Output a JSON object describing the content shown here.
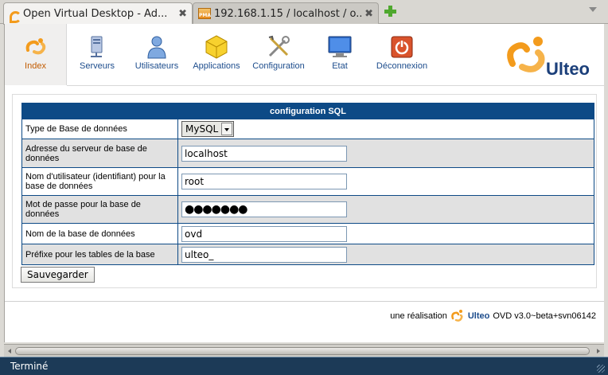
{
  "browser": {
    "tabs": [
      {
        "title": "Open Virtual Desktop - Ad...",
        "active": true,
        "icon": "ulteo-icon"
      },
      {
        "title": "192.168.1.15 / localhost / o...",
        "active": false,
        "icon": "phpmyadmin-icon"
      }
    ],
    "status_text": "Terminé"
  },
  "menu": {
    "items": [
      {
        "label": "Index",
        "icon": "ulteo-index-icon"
      },
      {
        "label": "Serveurs",
        "icon": "server-icon"
      },
      {
        "label": "Utilisateurs",
        "icon": "user-icon"
      },
      {
        "label": "Applications",
        "icon": "cube-icon"
      },
      {
        "label": "Configuration",
        "icon": "tools-icon"
      },
      {
        "label": "Etat",
        "icon": "monitor-icon"
      },
      {
        "label": "Déconnexion",
        "icon": "power-icon"
      }
    ],
    "selected": "Index"
  },
  "logo": {
    "text": "Ulteo",
    "colors": {
      "orange": "#f39b1c",
      "blue": "#1b3f7a"
    }
  },
  "form": {
    "title": "configuration SQL",
    "rows": [
      {
        "label": "Type de Base de données",
        "type": "select",
        "value": "MySQL"
      },
      {
        "label": "Adresse du serveur de base de données",
        "type": "text",
        "value": "localhost"
      },
      {
        "label": "Nom d'utilisateur (identifiant) pour la base de données",
        "type": "text",
        "value": "root"
      },
      {
        "label": "Mot de passe pour la base de données",
        "type": "password",
        "value": "●●●●●●●"
      },
      {
        "label": "Nom de la base de données",
        "type": "text",
        "value": "ovd"
      },
      {
        "label": "Préfixe pour les tables de la base",
        "type": "text",
        "value": "ulteo_"
      }
    ],
    "save_label": "Sauvegarder"
  },
  "footer": {
    "prefix": "une réalisation",
    "brand": "Ulteo",
    "version": "OVD v3.0~beta+svn06142"
  }
}
